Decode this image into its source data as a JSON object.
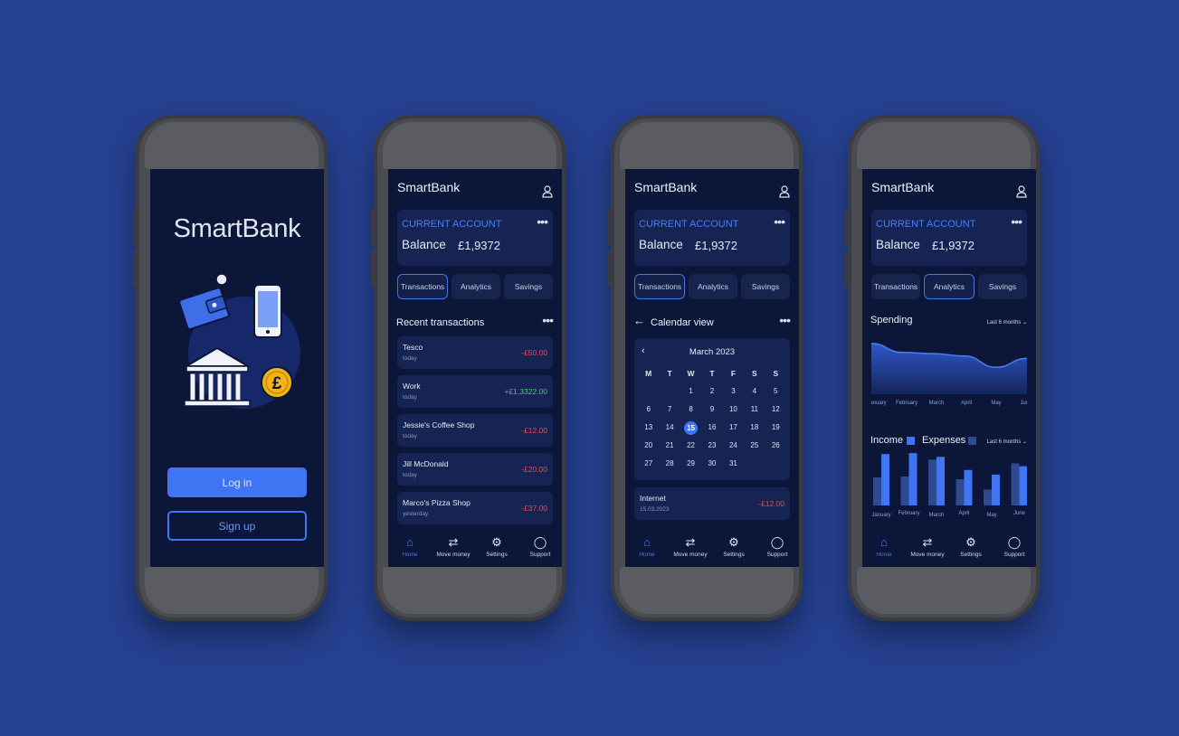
{
  "app_name": "SmartBank",
  "login": {
    "title": "SmartBank",
    "login_label": "Log in",
    "signup_label": "Sign up"
  },
  "account": {
    "label": "CURRENT ACCOUNT",
    "balance_label": "Balance",
    "balance_value": "£1,9372"
  },
  "tabs": [
    "Transactions",
    "Analytics",
    "Savings"
  ],
  "transactions_screen": {
    "title": "Recent transactions",
    "items": [
      {
        "name": "Tesco",
        "date": "today",
        "amount": "-£50.00",
        "type": "neg"
      },
      {
        "name": "Work",
        "date": "today",
        "amount": "+£1,3322.00",
        "type": "pos"
      },
      {
        "name": "Jessie's Coffee Shop",
        "date": "today",
        "amount": "-£12.00",
        "type": "neg"
      },
      {
        "name": "Jill McDonald",
        "date": "today",
        "amount": "-£20.00",
        "type": "neg"
      },
      {
        "name": "Marco's Pizza Shop",
        "date": "yesterday",
        "amount": "-£37.00",
        "type": "neg"
      }
    ]
  },
  "calendar_screen": {
    "title": "Calendar view",
    "month": "March 2023",
    "weekdays": [
      "M",
      "T",
      "W",
      "T",
      "F",
      "S",
      "S"
    ],
    "days": [
      "",
      "",
      "1",
      "2",
      "3",
      "4",
      "5",
      "6",
      "7",
      "8",
      "9",
      "10",
      "11",
      "12",
      "13",
      "14",
      "15",
      "16",
      "17",
      "18",
      "19",
      "20",
      "21",
      "22",
      "23",
      "24",
      "25",
      "26",
      "27",
      "28",
      "29",
      "30",
      "31",
      "",
      ""
    ],
    "selected_day": "15",
    "transaction": {
      "name": "Internet",
      "date": "15.03.2023",
      "amount": "-£12.00"
    }
  },
  "analytics_screen": {
    "spending_title": "Spending",
    "range_label": "Last 6 months",
    "income_label": "Income",
    "expenses_label": "Expenses",
    "months": [
      "January",
      "February",
      "March",
      "April",
      "May",
      "June"
    ]
  },
  "nav": {
    "home": "Home",
    "move_money": "Move money",
    "settings": "Settings",
    "support": "Support"
  },
  "colors": {
    "background": "#25408f",
    "screen": "#0b1638",
    "card": "#152453",
    "accent": "#3f74f3",
    "negative": "#e64c55",
    "positive": "#52c572"
  },
  "chart_data": [
    {
      "type": "area",
      "title": "Spending",
      "x": [
        "January",
        "February",
        "March",
        "April",
        "May",
        "June"
      ],
      "series": [
        {
          "values": [
            85,
            70,
            68,
            64,
            45,
            60
          ]
        }
      ],
      "ylim": [
        0,
        100
      ]
    },
    {
      "type": "bar",
      "categories": [
        "January",
        "February",
        "March",
        "April",
        "May",
        "June"
      ],
      "series": [
        {
          "name": "Income",
          "values": [
            55,
            56,
            52,
            38,
            33,
            42
          ]
        },
        {
          "name": "Expenses",
          "values": [
            30,
            31,
            49,
            28,
            17,
            45
          ]
        }
      ],
      "ylim": [
        0,
        60
      ]
    }
  ]
}
